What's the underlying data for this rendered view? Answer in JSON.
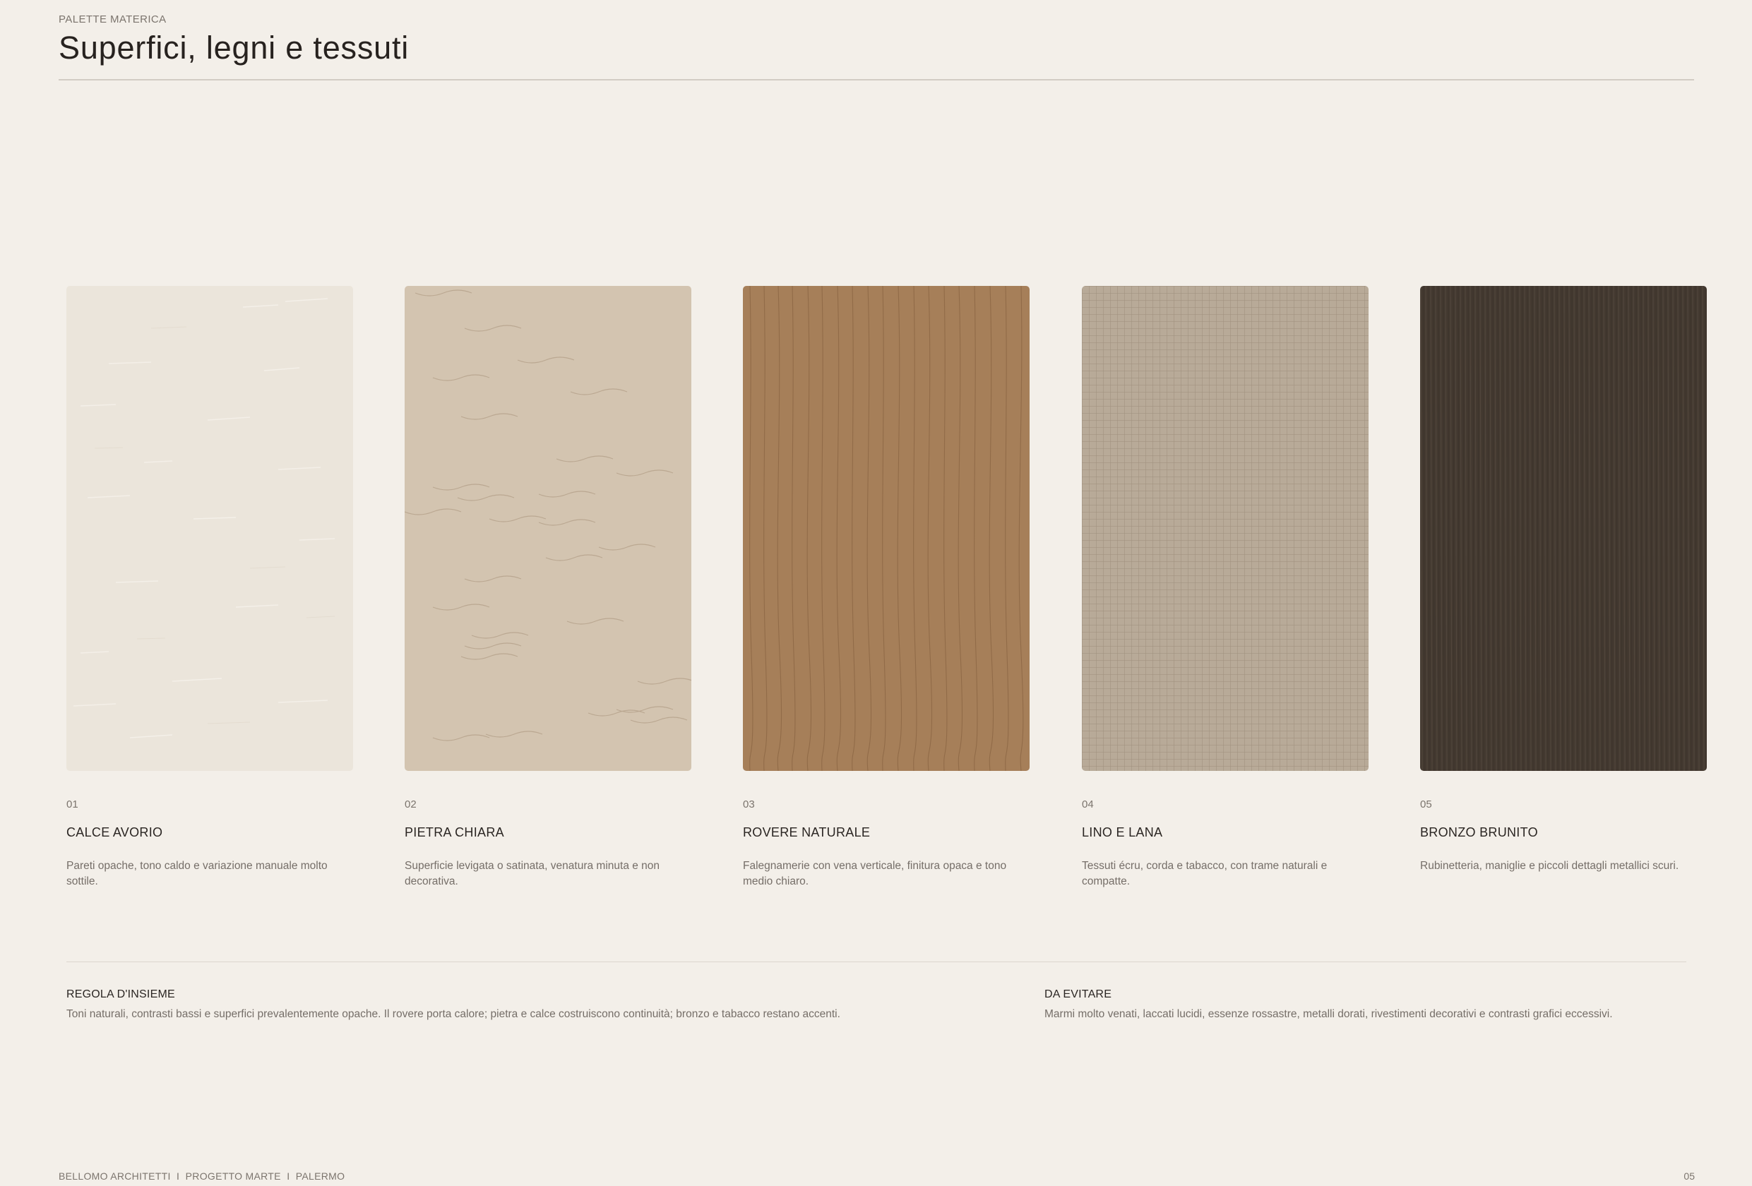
{
  "header": {
    "eyebrow": "PALETTE MATERICA",
    "title": "Superfici, legni e tessuti"
  },
  "materials": [
    {
      "number": "01",
      "name": "CALCE AVORIO",
      "description": "Pareti opache, tono caldo e variazione manuale molto sottile.",
      "color": "#ebe5db",
      "texture": "plaster-icon"
    },
    {
      "number": "02",
      "name": "PIETRA CHIARA",
      "description": "Superficie levigata o satinata, venatura minuta e non decorativa.",
      "color": "#d3c4b0",
      "texture": "stone-veins-icon"
    },
    {
      "number": "03",
      "name": "ROVERE NATURALE",
      "description": "Falegnamerie con vena verticale, finitura opaca e tono medio chiaro.",
      "color": "#a67f59",
      "texture": "wood-grain-icon"
    },
    {
      "number": "04",
      "name": "LINO E LANA",
      "description": "Tessuti écru, corda e tabacco, con trame naturali e compatte.",
      "color": "#b8aa98",
      "texture": "fabric-weave-icon"
    },
    {
      "number": "05",
      "name": "BRONZO BRUNITO",
      "description": "Rubinetteria, maniglie e piccoli dettagli metallici scuri.",
      "color": "#433930",
      "texture": "brushed-metal-icon"
    }
  ],
  "rules": {
    "general": {
      "title": "REGOLA D'INSIEME",
      "text": "Toni naturali, contrasti bassi e superfici prevalentemente opache. Il rovere porta calore; pietra e calce costruiscono continuità; bronzo e tabacco restano accenti."
    },
    "avoid": {
      "title": "DA EVITARE",
      "text": "Marmi molto venati, laccati lucidi, essenze rossastre, metalli dorati, rivestimenti decorativi e contrasti grafici eccessivi."
    }
  },
  "footer": {
    "studio": "BELLOMO ARCHITETTI",
    "separator": "I",
    "project": "PROGETTO MARTE",
    "city": "PALERMO",
    "page_number": "05"
  }
}
